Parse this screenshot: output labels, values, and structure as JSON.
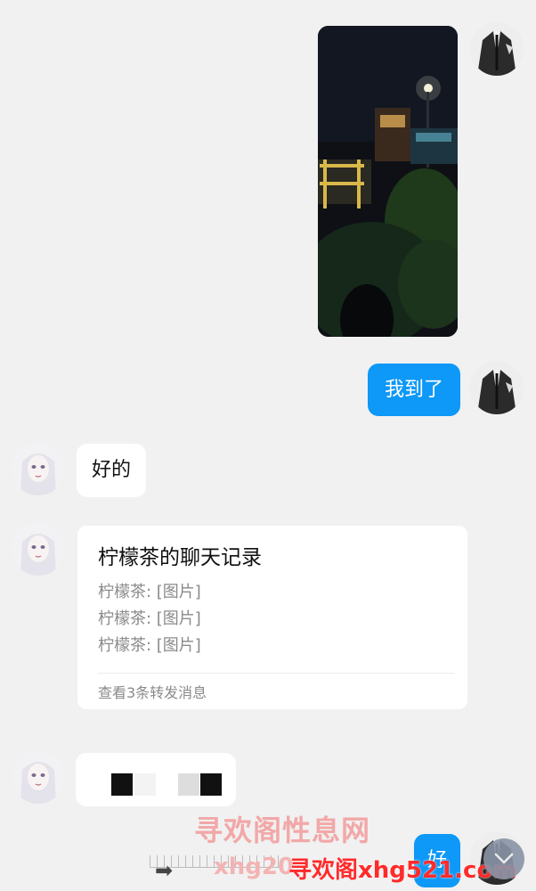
{
  "messages": {
    "sent_text_1": "我到了",
    "received_text_1": "好的",
    "sent_text_2": "好"
  },
  "forward_card": {
    "title": "柠檬茶的聊天记录",
    "lines": [
      "柠檬茶: [图片]",
      "柠檬茶: [图片]",
      "柠檬茶: [图片]"
    ],
    "footer": "查看3条转发消息"
  },
  "watermark": {
    "brand": "寻欢阁性息网",
    "url_partial": "xhg20",
    "url_overlay": "寻欢阁xhg521.com"
  },
  "colors": {
    "background": "#f1f1f1",
    "sent_bubble": "#0e98f7",
    "received_bubble": "#ffffff"
  },
  "icons": {
    "scroll_button": "chevron-down-icon"
  }
}
